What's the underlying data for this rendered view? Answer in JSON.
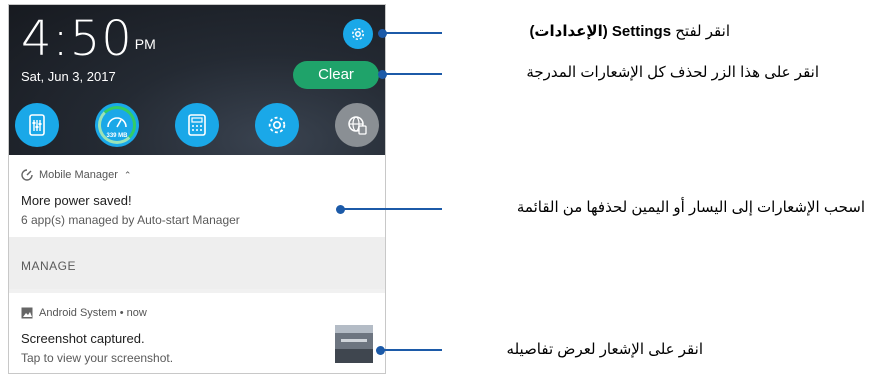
{
  "status": {
    "time": "4:50",
    "ampm": "PM",
    "date": "Sat, Jun 3, 2017"
  },
  "quick_settings": {
    "clear_label": "Clear",
    "settings_icon": "gear-icon",
    "tiles": [
      {
        "name": "audio-wizard-icon",
        "color": "#1aa8e8"
      },
      {
        "name": "boost-icon",
        "label": "339 MB",
        "color": "#1aa8e8"
      },
      {
        "name": "calculator-icon",
        "color": "#1aa8e8"
      },
      {
        "name": "settings-tile-icon",
        "color": "#1aa8e8"
      },
      {
        "name": "network-icon",
        "color": "#8a8f94"
      }
    ]
  },
  "notifications": [
    {
      "app": "Mobile Manager",
      "title": "More power saved!",
      "body": "6 app(s) managed by Auto-start Manager"
    },
    {
      "app": "Android System • now",
      "title": "Screenshot captured.",
      "body": "Tap to view your screenshot."
    }
  ],
  "manage_label": "MANAGE",
  "callouts": {
    "settings_prefix": "انقر لفتح",
    "settings_word": "Settings",
    "settings_suffix": "(الإعدادات)",
    "clear": "انقر على هذا الزر لحذف كل الإشعارات المدرجة",
    "swipe": "اسحب الإشعارات إلى اليسار أو اليمين لحذفها من القائمة",
    "tap": "انقر على الإشعار لعرض تفاصيله"
  },
  "colors": {
    "accent_blue": "#1aa8e8",
    "clear_green": "#1fa36a",
    "callout_line": "#1c5aa8"
  }
}
